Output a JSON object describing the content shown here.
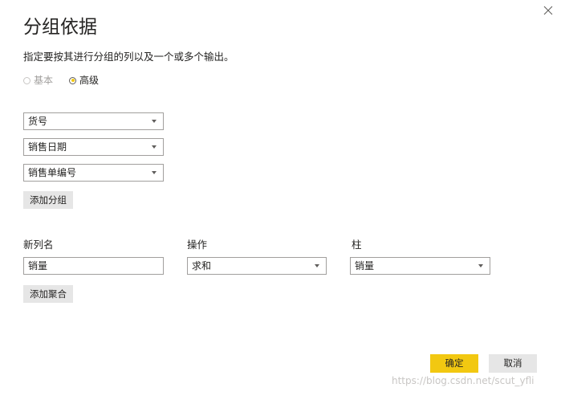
{
  "dialog": {
    "title": "分组依据",
    "subtitle": "指定要按其进行分组的列以及一个或多个输出。",
    "close_icon": "close-icon"
  },
  "mode": {
    "basic_label": "基本",
    "advanced_label": "高级",
    "selected": "advanced"
  },
  "group_by": {
    "fields": [
      {
        "value": "货号"
      },
      {
        "value": "销售日期"
      },
      {
        "value": "销售单编号"
      }
    ],
    "add_group_label": "添加分组"
  },
  "aggregation": {
    "new_column_header": "新列名",
    "operation_header": "操作",
    "column_header": "柱",
    "new_column_value": "销量",
    "operation_value": "求和",
    "column_value": "销量",
    "add_aggregation_label": "添加聚合"
  },
  "footer": {
    "ok_label": "确定",
    "cancel_label": "取消"
  },
  "watermark": "https://blog.csdn.net/scut_yfli",
  "colors": {
    "accent": "#f2c811",
    "button_gray": "#e6e6e6",
    "border": "#a19f9d"
  }
}
